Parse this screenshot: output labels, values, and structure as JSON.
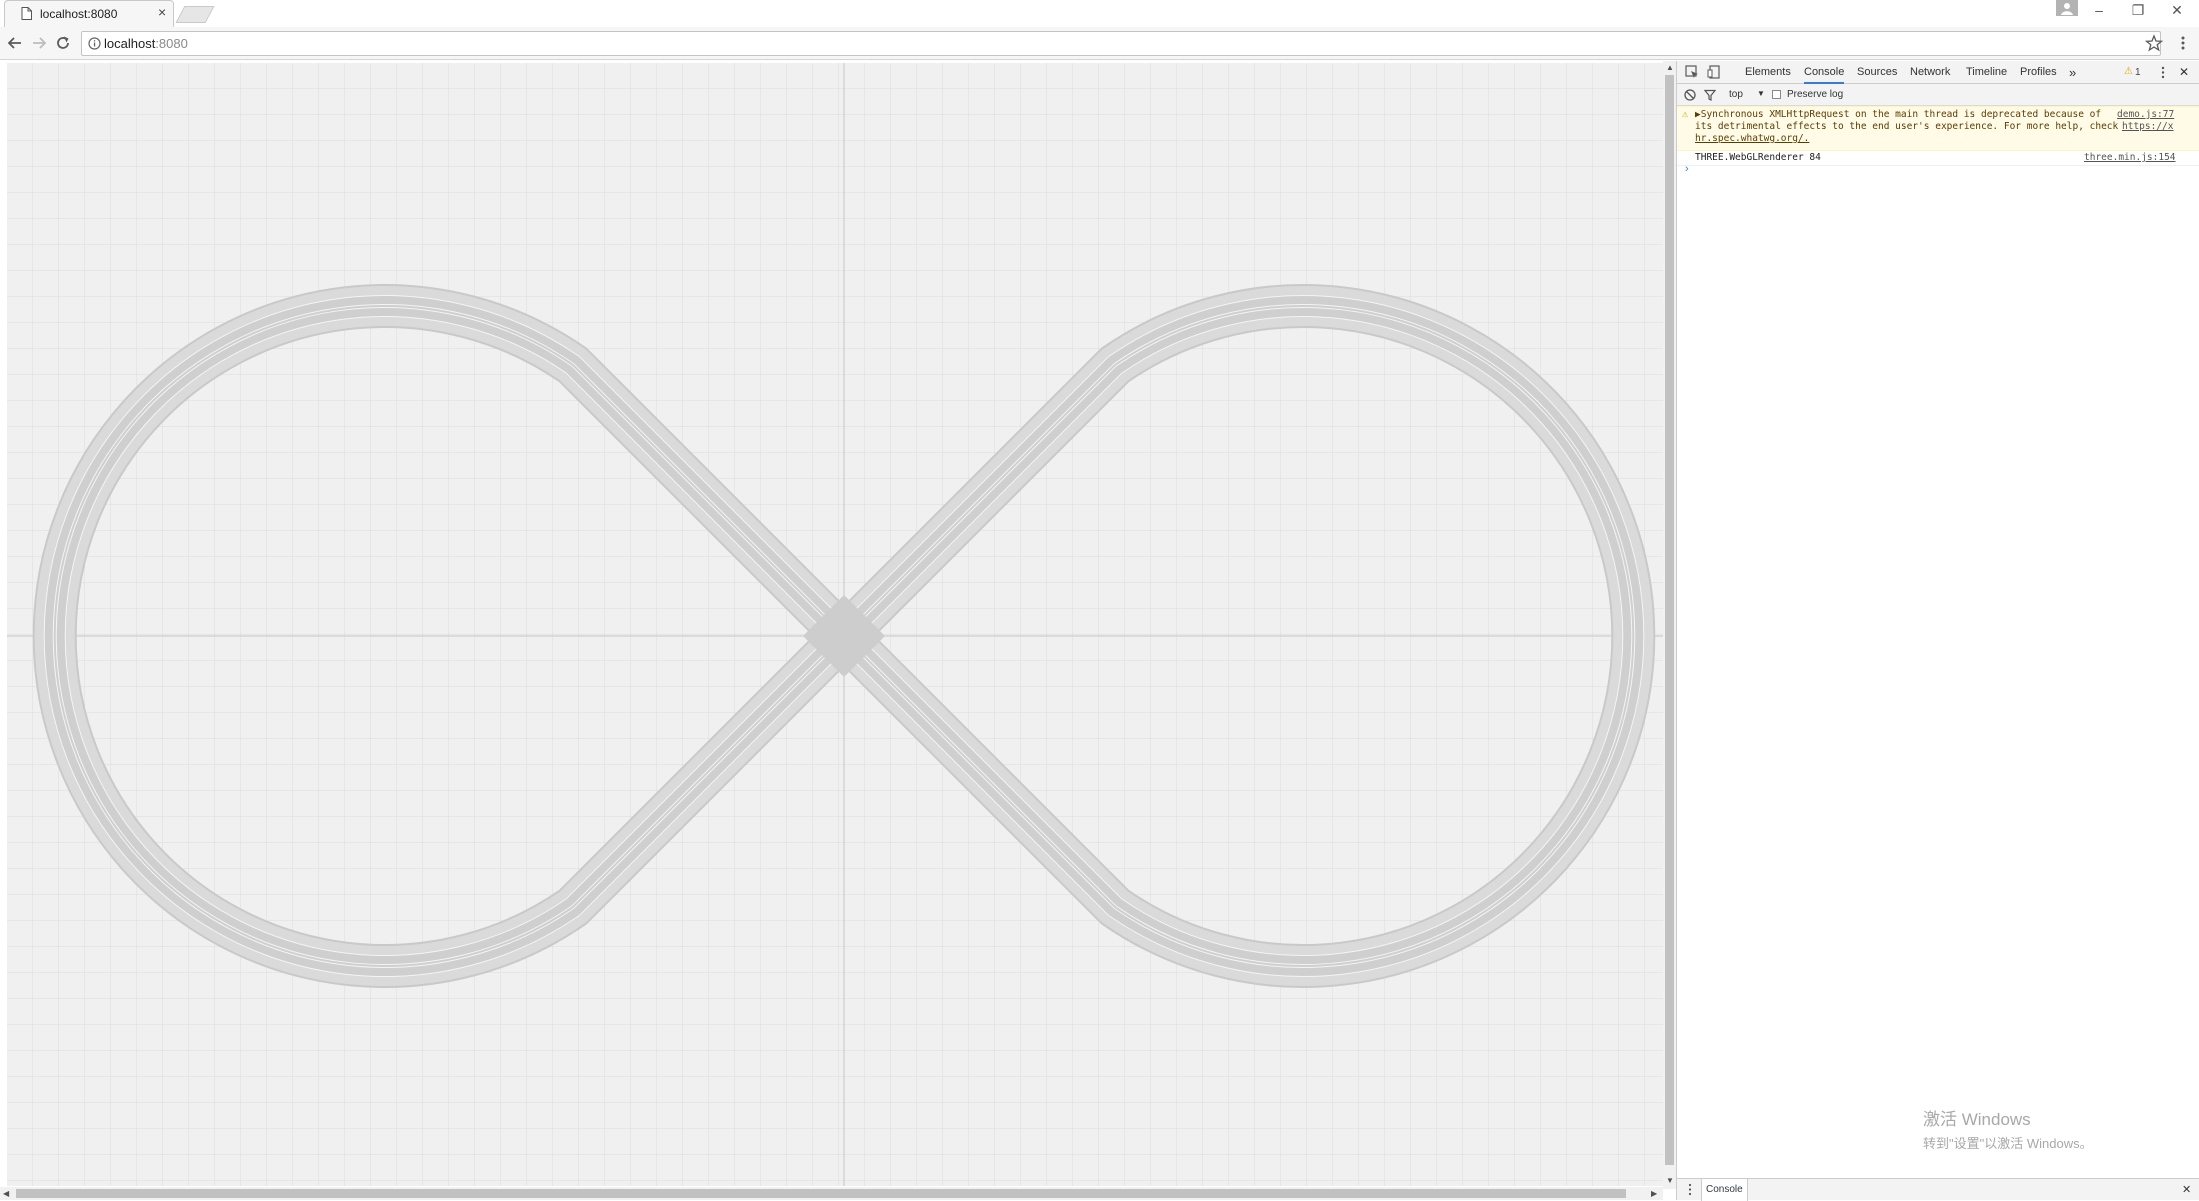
{
  "browser": {
    "tab_title": "localhost:8080",
    "tab_close": "×",
    "window_controls": {
      "minimize": "–",
      "restore": "❐",
      "close": "✕"
    },
    "url_host": "localhost",
    "url_port": ":8080"
  },
  "devtools": {
    "tabs": [
      "Elements",
      "Console",
      "Sources",
      "Network",
      "Timeline",
      "Profiles"
    ],
    "active_tab": "Console",
    "more_tabs": "»",
    "warning_count": "1",
    "context": "top",
    "preserve_log_label": "Preserve log",
    "messages": [
      {
        "level": "warning",
        "text_lines": [
          "▶Synchronous XMLHttpRequest on the main thread is deprecated because of",
          "its detrimental effects to the end user's experience. For more help, check",
          "hr.spec.whatwg.org/."
        ],
        "source": "demo.js:77",
        "link_part": "https://x"
      },
      {
        "level": "log",
        "text": "THREE.WebGLRenderer 84",
        "source": "three.min.js:154"
      }
    ],
    "prompt": "›",
    "drawer_tab": "Console",
    "drawer_close": "✕"
  },
  "os_watermark": {
    "line1": "激活 Windows",
    "line2": "转到\"设置\"以激活 Windows。"
  },
  "colors": {
    "canvas_bg": "#f0f0f0",
    "grid_line": "#dcdcdc",
    "track": "#cbcbcb",
    "track_lane_line": "#f4f4f4",
    "accent": "#3879d9",
    "warning_bg": "#fffbe6"
  },
  "icons": [
    "page-icon",
    "back-icon",
    "forward-icon",
    "reload-icon",
    "info-icon",
    "star-icon",
    "menu-icon",
    "inspect-icon",
    "device-icon",
    "warning-icon",
    "clear-icon",
    "filter-icon",
    "close-icon"
  ]
}
